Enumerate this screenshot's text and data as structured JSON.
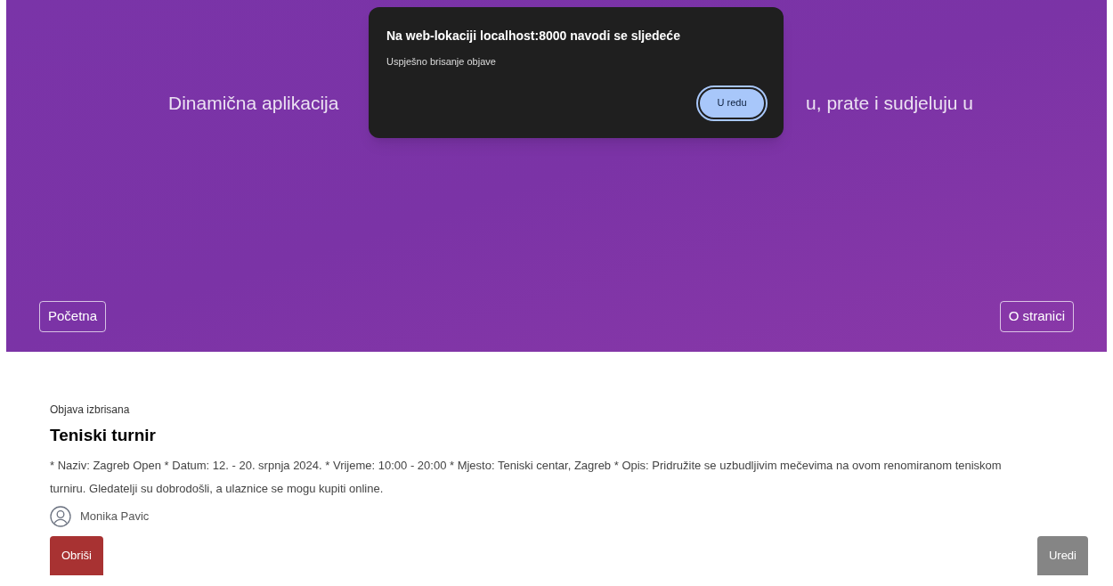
{
  "header": {
    "tagline_left": "Dinamična aplikacija",
    "tagline_right": "u, prate i sudjeluju u",
    "nav": [
      {
        "label": "Početna"
      },
      {
        "label": "O stranici"
      }
    ]
  },
  "dialog": {
    "title": "Na web-lokaciji localhost:8000 navodi se sljedeće",
    "message": "Uspješno brisanje objave",
    "button": "U redu"
  },
  "post": {
    "status": "Objava izbrisana",
    "title": "Teniski turnir",
    "body": "* Naziv: Zagreb Open * Datum: 12. - 20. srpnja 2024. * Vrijeme: 10:00 - 20:00 * Mjesto: Teniski centar, Zagreb * Opis: Pridružite se uzbudljivim mečevima na ovom renomiranom teniskom turniru. Gledatelji su dobrodošli, a ulaznice se mogu kupiti online.",
    "author": "Monika Pavic",
    "actions": [
      {
        "kind": "delete",
        "label": "Obriši"
      },
      {
        "kind": "edit",
        "label": "Uredi"
      }
    ]
  }
}
